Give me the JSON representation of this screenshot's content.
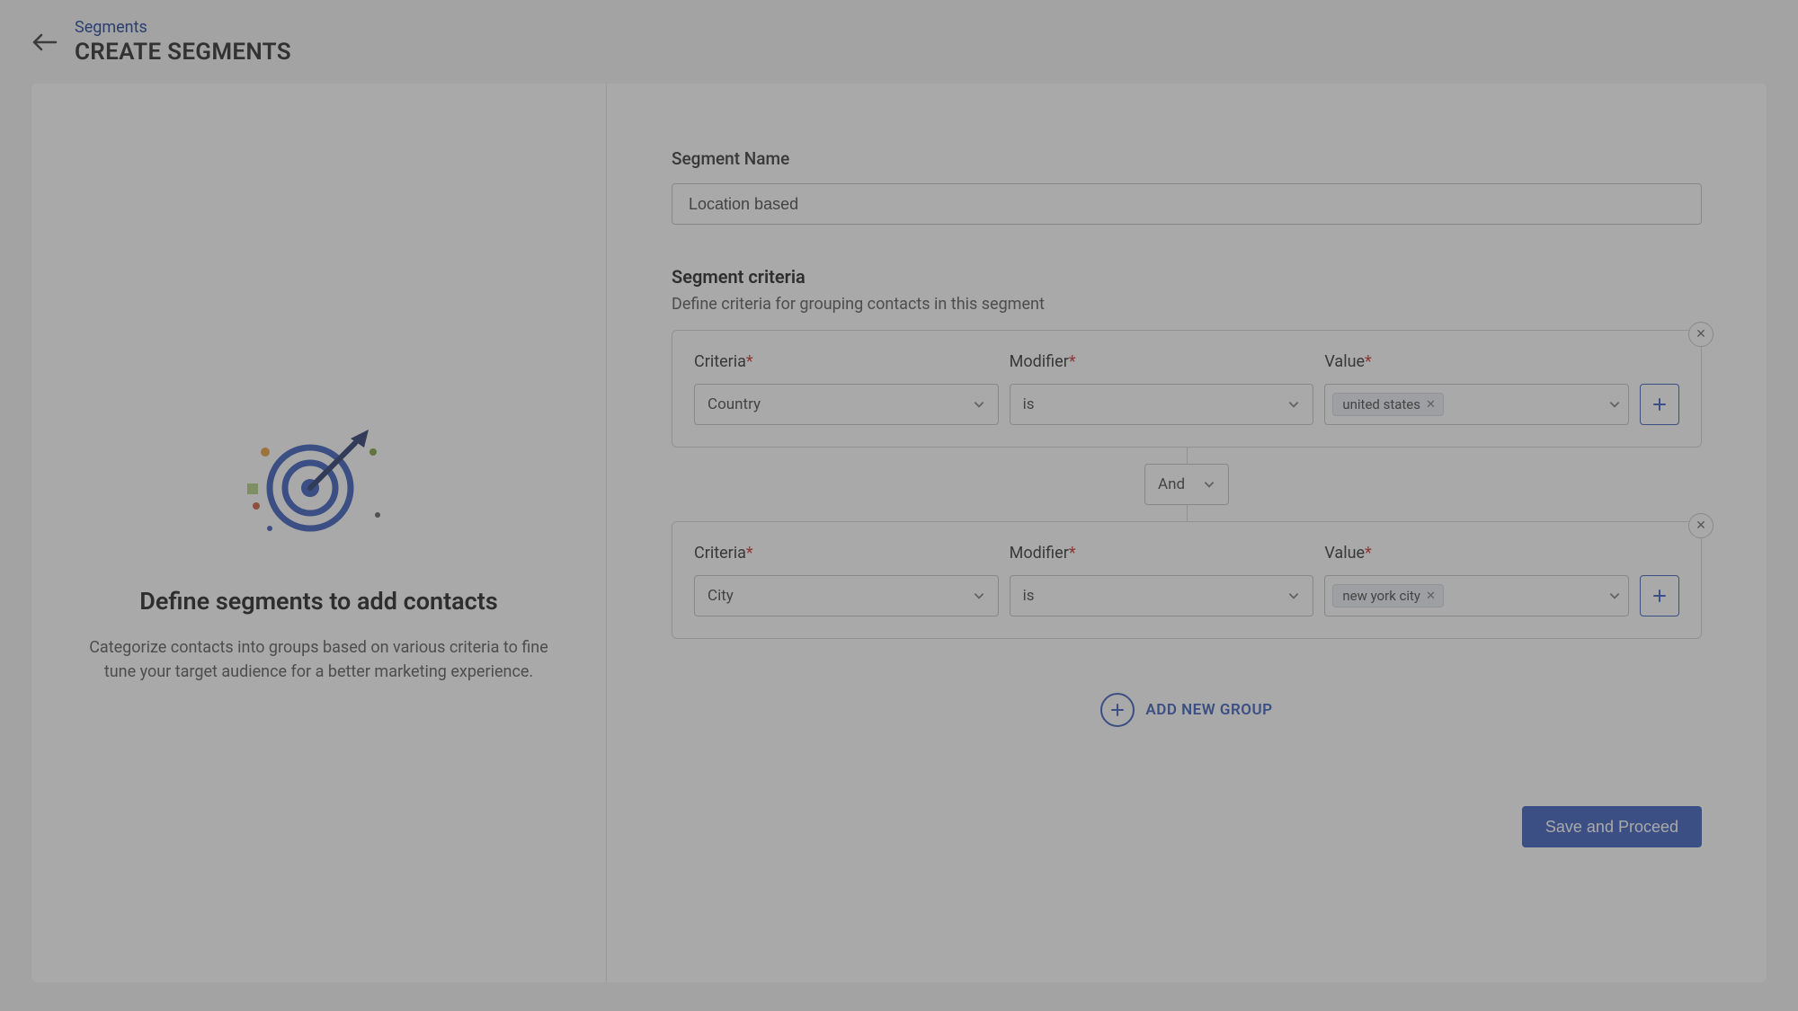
{
  "breadcrumb": {
    "parent": "Segments",
    "title": "CREATE SEGMENTS"
  },
  "left_panel": {
    "title": "Define segments to add contacts",
    "description": "Categorize contacts into groups based on various criteria to fine tune your target audience for a better marketing experience."
  },
  "form": {
    "segment_name_label": "Segment Name",
    "segment_name_value": "Location based",
    "criteria_section_title": "Segment criteria",
    "criteria_section_description": "Define criteria for grouping contacts in this segment",
    "labels": {
      "criteria": "Criteria",
      "modifier": "Modifier",
      "value": "Value"
    },
    "groups": [
      {
        "criteria": "Country",
        "modifier": "is",
        "value_tag": "united states"
      },
      {
        "criteria": "City",
        "modifier": "is",
        "value_tag": "new york city"
      }
    ],
    "connector": "And",
    "add_group_label": "ADD NEW GROUP",
    "save_button": "Save and Proceed"
  }
}
